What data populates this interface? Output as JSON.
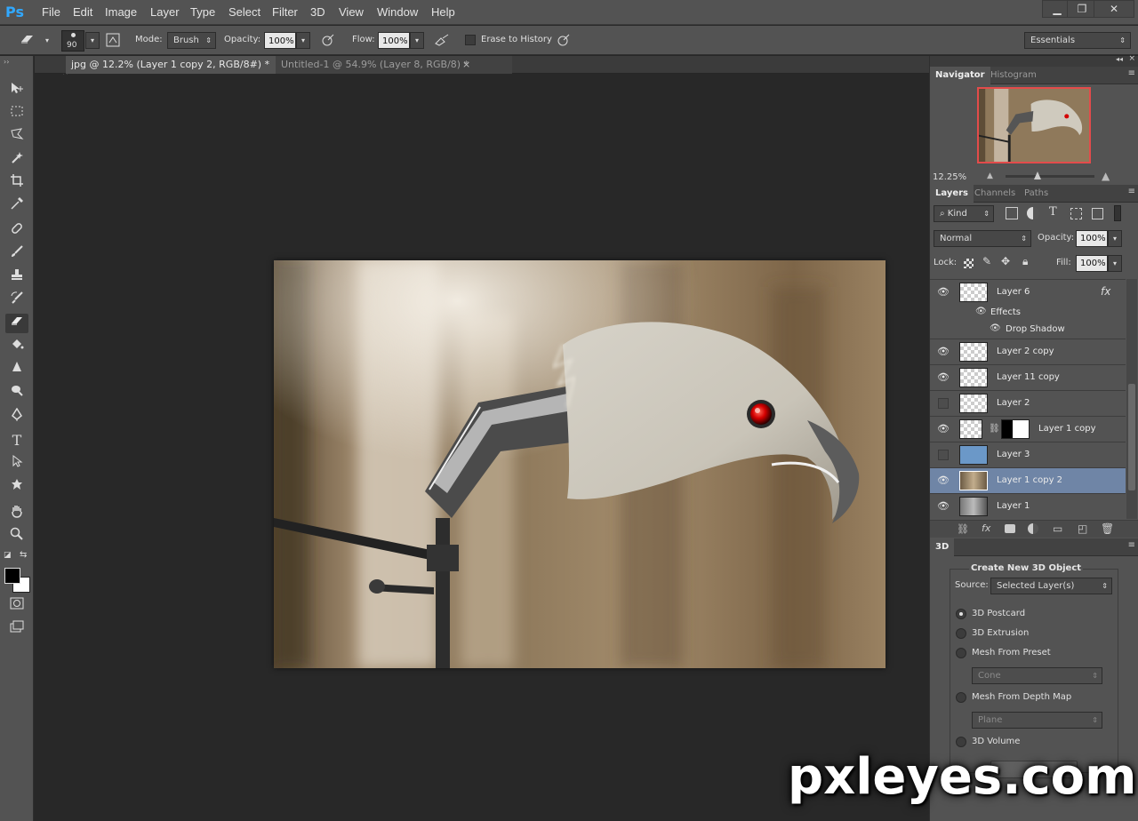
{
  "app": {
    "logo": "Ps"
  },
  "menu": [
    "File",
    "Edit",
    "Image",
    "Layer",
    "Type",
    "Select",
    "Filter",
    "3D",
    "View",
    "Window",
    "Help"
  ],
  "window_controls": {
    "minimize": "▁",
    "restore": "❐",
    "close": "✕"
  },
  "options": {
    "brush_size": "90",
    "mode_label": "Mode:",
    "mode_value": "Brush",
    "opacity_label": "Opacity:",
    "opacity_value": "100%",
    "flow_label": "Flow:",
    "flow_value": "100%",
    "erase_history_label": "Erase to History",
    "workspace": "Essentials"
  },
  "tabs": [
    {
      "label": "jpg @ 12.2% (Layer 1 copy 2, RGB/8#) *",
      "active": true
    },
    {
      "label": "Untitled-1 @ 54.9% (Layer 8, RGB/8) *",
      "active": false
    }
  ],
  "navigator": {
    "tabs": [
      "Navigator",
      "Histogram"
    ],
    "zoom": "12.25%"
  },
  "layers_panel": {
    "tabs": [
      "Layers",
      "Channels",
      "Paths"
    ],
    "filter_kind": "Kind",
    "blend_mode": "Normal",
    "opacity_label": "Opacity:",
    "opacity_value": "100%",
    "lock_label": "Lock:",
    "fill_label": "Fill:",
    "fill_value": "100%",
    "effects_label": "Effects",
    "drop_shadow_label": "Drop Shadow",
    "fx_badge": "fx",
    "layers": [
      {
        "name": "Layer 6",
        "visible": true,
        "fx": true
      },
      {
        "name": "Layer 2 copy",
        "visible": true
      },
      {
        "name": "Layer 11 copy",
        "visible": true
      },
      {
        "name": "Layer 2",
        "visible": false
      },
      {
        "name": "Layer 1 copy",
        "visible": true,
        "mask": true
      },
      {
        "name": "Layer 3",
        "visible": false
      },
      {
        "name": "Layer 1 copy 2",
        "visible": true,
        "selected": true
      },
      {
        "name": "Layer 1",
        "visible": true
      }
    ]
  },
  "panel_3d": {
    "tab": "3D",
    "heading": "Create New 3D Object",
    "source_label": "Source:",
    "source_value": "Selected Layer(s)",
    "options": [
      {
        "label": "3D Postcard",
        "selected": true
      },
      {
        "label": "3D Extrusion",
        "selected": false
      },
      {
        "label": "Mesh From Preset",
        "selected": false
      },
      {
        "label": "Mesh From Depth Map",
        "selected": false
      },
      {
        "label": "3D Volume",
        "selected": false
      }
    ],
    "preset_value": "Cone",
    "depth_value": "Plane"
  },
  "watermark": "pxleyes.com",
  "colors": {
    "ui_dark": "#282828",
    "ui_panel": "#535353",
    "selection": "#6f85a6",
    "eye_red": "#d40000"
  }
}
